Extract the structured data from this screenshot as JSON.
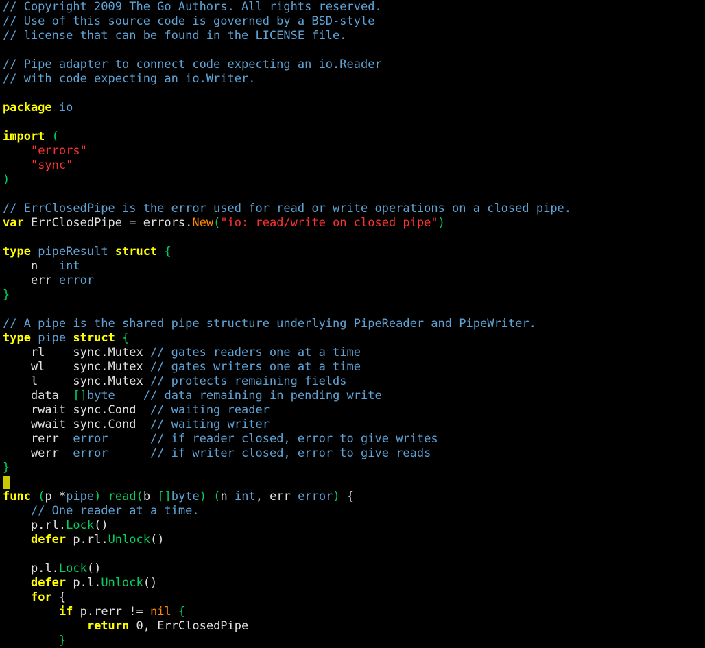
{
  "lines": [
    [
      {
        "cls": "c",
        "t": "// Copyright 2009 The Go Authors. All rights reserved."
      }
    ],
    [
      {
        "cls": "c",
        "t": "// Use of this source code is governed by a BSD-style"
      }
    ],
    [
      {
        "cls": "c",
        "t": "// license that can be found in the LICENSE file."
      }
    ],
    [],
    [
      {
        "cls": "c",
        "t": "// Pipe adapter to connect code expecting an io.Reader"
      }
    ],
    [
      {
        "cls": "c",
        "t": "// with code expecting an io.Writer."
      }
    ],
    [],
    [
      {
        "cls": "kw",
        "t": "package"
      },
      {
        "cls": "pl",
        "t": " "
      },
      {
        "cls": "ty",
        "t": "io"
      }
    ],
    [],
    [
      {
        "cls": "kw",
        "t": "import"
      },
      {
        "cls": "pl",
        "t": " "
      },
      {
        "cls": "gr",
        "t": "("
      }
    ],
    [
      {
        "cls": "pl",
        "t": "    "
      },
      {
        "cls": "st",
        "t": "\"errors\""
      }
    ],
    [
      {
        "cls": "pl",
        "t": "    "
      },
      {
        "cls": "st",
        "t": "\"sync\""
      }
    ],
    [
      {
        "cls": "gr",
        "t": ")"
      }
    ],
    [],
    [
      {
        "cls": "c",
        "t": "// ErrClosedPipe is the error used for read or write operations on a closed pipe."
      }
    ],
    [
      {
        "cls": "kw",
        "t": "var"
      },
      {
        "cls": "pl",
        "t": " ErrClosedPipe = errors."
      },
      {
        "cls": "or",
        "t": "New"
      },
      {
        "cls": "gr",
        "t": "("
      },
      {
        "cls": "st",
        "t": "\"io: read/write on closed pipe\""
      },
      {
        "cls": "gr",
        "t": ")"
      }
    ],
    [],
    [
      {
        "cls": "kw",
        "t": "type"
      },
      {
        "cls": "pl",
        "t": " "
      },
      {
        "cls": "ty",
        "t": "pipeResult"
      },
      {
        "cls": "pl",
        "t": " "
      },
      {
        "cls": "kw",
        "t": "struct"
      },
      {
        "cls": "pl",
        "t": " "
      },
      {
        "cls": "gr",
        "t": "{"
      }
    ],
    [
      {
        "cls": "pl",
        "t": "    n   "
      },
      {
        "cls": "ty",
        "t": "int"
      }
    ],
    [
      {
        "cls": "pl",
        "t": "    err "
      },
      {
        "cls": "ty",
        "t": "error"
      }
    ],
    [
      {
        "cls": "gr",
        "t": "}"
      }
    ],
    [],
    [
      {
        "cls": "c",
        "t": "// A pipe is the shared pipe structure underlying PipeReader and PipeWriter."
      }
    ],
    [
      {
        "cls": "kw",
        "t": "type"
      },
      {
        "cls": "pl",
        "t": " "
      },
      {
        "cls": "ty",
        "t": "pipe"
      },
      {
        "cls": "pl",
        "t": " "
      },
      {
        "cls": "kw",
        "t": "struct"
      },
      {
        "cls": "pl",
        "t": " "
      },
      {
        "cls": "gr",
        "t": "{"
      }
    ],
    [
      {
        "cls": "pl",
        "t": "    rl    sync.Mutex "
      },
      {
        "cls": "c",
        "t": "// gates readers one at a time"
      }
    ],
    [
      {
        "cls": "pl",
        "t": "    wl    sync.Mutex "
      },
      {
        "cls": "c",
        "t": "// gates writers one at a time"
      }
    ],
    [
      {
        "cls": "pl",
        "t": "    l     sync.Mutex "
      },
      {
        "cls": "c",
        "t": "// protects remaining fields"
      }
    ],
    [
      {
        "cls": "pl",
        "t": "    data  "
      },
      {
        "cls": "gr",
        "t": "[]"
      },
      {
        "cls": "ty",
        "t": "byte"
      },
      {
        "cls": "pl",
        "t": "    "
      },
      {
        "cls": "c",
        "t": "// data remaining in pending write"
      }
    ],
    [
      {
        "cls": "pl",
        "t": "    rwait sync.Cond  "
      },
      {
        "cls": "c",
        "t": "// waiting reader"
      }
    ],
    [
      {
        "cls": "pl",
        "t": "    wwait sync.Cond  "
      },
      {
        "cls": "c",
        "t": "// waiting writer"
      }
    ],
    [
      {
        "cls": "pl",
        "t": "    rerr  "
      },
      {
        "cls": "ty",
        "t": "error"
      },
      {
        "cls": "pl",
        "t": "      "
      },
      {
        "cls": "c",
        "t": "// if reader closed, error to give writes"
      }
    ],
    [
      {
        "cls": "pl",
        "t": "    werr  "
      },
      {
        "cls": "ty",
        "t": "error"
      },
      {
        "cls": "pl",
        "t": "      "
      },
      {
        "cls": "c",
        "t": "// if writer closed, error to give reads"
      }
    ],
    [
      {
        "cls": "gr",
        "t": "}"
      }
    ],
    [
      {
        "cursor": true
      }
    ],
    [
      {
        "cls": "kw",
        "t": "func"
      },
      {
        "cls": "pl",
        "t": " "
      },
      {
        "cls": "gr",
        "t": "("
      },
      {
        "cls": "pl",
        "t": "p *"
      },
      {
        "cls": "ty",
        "t": "pipe"
      },
      {
        "cls": "gr",
        "t": ")"
      },
      {
        "cls": "pl",
        "t": " "
      },
      {
        "cls": "gr",
        "t": "read"
      },
      {
        "cls": "gr",
        "t": "("
      },
      {
        "cls": "pl",
        "t": "b "
      },
      {
        "cls": "gr",
        "t": "[]"
      },
      {
        "cls": "ty",
        "t": "byte"
      },
      {
        "cls": "gr",
        "t": ")"
      },
      {
        "cls": "pl",
        "t": " "
      },
      {
        "cls": "gr",
        "t": "("
      },
      {
        "cls": "pl",
        "t": "n "
      },
      {
        "cls": "ty",
        "t": "int"
      },
      {
        "cls": "pl",
        "t": ", err "
      },
      {
        "cls": "ty",
        "t": "error"
      },
      {
        "cls": "gr",
        "t": ")"
      },
      {
        "cls": "pl",
        "t": " {"
      }
    ],
    [
      {
        "cls": "pl",
        "t": "    "
      },
      {
        "cls": "c",
        "t": "// One reader at a time."
      }
    ],
    [
      {
        "cls": "pl",
        "t": "    p.rl."
      },
      {
        "cls": "gr",
        "t": "Lock"
      },
      {
        "cls": "pl",
        "t": "()"
      }
    ],
    [
      {
        "cls": "pl",
        "t": "    "
      },
      {
        "cls": "kw",
        "t": "defer"
      },
      {
        "cls": "pl",
        "t": " p.rl."
      },
      {
        "cls": "gr",
        "t": "Unlock"
      },
      {
        "cls": "pl",
        "t": "()"
      }
    ],
    [],
    [
      {
        "cls": "pl",
        "t": "    p.l."
      },
      {
        "cls": "gr",
        "t": "Lock"
      },
      {
        "cls": "pl",
        "t": "()"
      }
    ],
    [
      {
        "cls": "pl",
        "t": "    "
      },
      {
        "cls": "kw",
        "t": "defer"
      },
      {
        "cls": "pl",
        "t": " p.l."
      },
      {
        "cls": "gr",
        "t": "Unlock"
      },
      {
        "cls": "pl",
        "t": "()"
      }
    ],
    [
      {
        "cls": "pl",
        "t": "    "
      },
      {
        "cls": "kw",
        "t": "for"
      },
      {
        "cls": "pl",
        "t": " {"
      }
    ],
    [
      {
        "cls": "pl",
        "t": "        "
      },
      {
        "cls": "kw",
        "t": "if"
      },
      {
        "cls": "pl",
        "t": " p.rerr != "
      },
      {
        "cls": "or",
        "t": "nil"
      },
      {
        "cls": "pl",
        "t": " "
      },
      {
        "cls": "gr",
        "t": "{"
      }
    ],
    [
      {
        "cls": "pl",
        "t": "            "
      },
      {
        "cls": "kw",
        "t": "return"
      },
      {
        "cls": "pl",
        "t": " 0, ErrClosedPipe"
      }
    ],
    [
      {
        "cls": "pl",
        "t": "        "
      },
      {
        "cls": "gr",
        "t": "}"
      }
    ]
  ]
}
